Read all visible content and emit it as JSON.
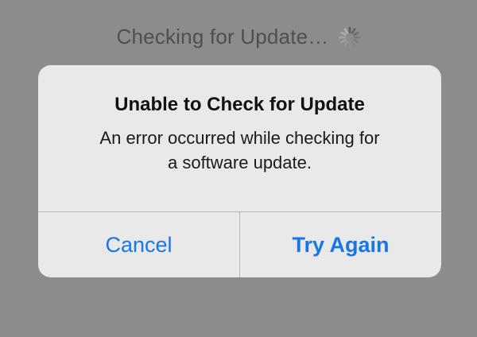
{
  "status": {
    "text": "Checking for Update…",
    "indicator_icon": "activity-spinner-icon"
  },
  "alert": {
    "title": "Unable to Check for Update",
    "message": "An error occurred while checking for a software update.",
    "buttons": {
      "cancel": "Cancel",
      "retry": "Try Again"
    }
  },
  "colors": {
    "background": "#8c8c8c",
    "alert_background": "#e9e9e9",
    "button_text": "#1777e6"
  }
}
